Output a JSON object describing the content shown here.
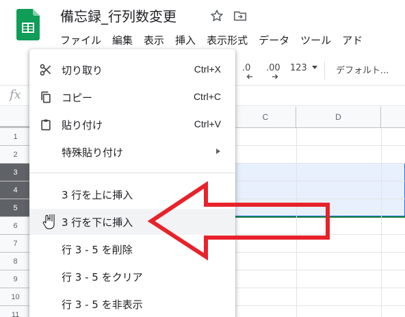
{
  "app": {
    "doc_title": "備忘録_行列数変更",
    "menu": [
      "ファイル",
      "編集",
      "表示",
      "挿入",
      "表示形式",
      "データ",
      "ツール",
      "アド"
    ]
  },
  "toolbar": {
    "decimal_decrease": ".0",
    "decimal_increase": ".00",
    "number_format": "123",
    "font_name": "デフォルト..."
  },
  "formula_bar": {
    "fx_label": "fx"
  },
  "grid": {
    "columns": [
      "C",
      "D"
    ],
    "rows": [
      "1",
      "2",
      "3",
      "4",
      "5",
      "6",
      "7",
      "8",
      "9",
      "10",
      "11"
    ],
    "selected_rows": [
      "3",
      "4",
      "5"
    ]
  },
  "context_menu": {
    "items": [
      {
        "label": "切り取り",
        "shortcut": "Ctrl+X",
        "icon": "scissors-icon"
      },
      {
        "label": "コピー",
        "shortcut": "Ctrl+C",
        "icon": "copy-icon"
      },
      {
        "label": "貼り付け",
        "shortcut": "Ctrl+V",
        "icon": "clipboard-icon"
      },
      {
        "label": "特殊貼り付け",
        "submenu": true
      },
      {
        "label": "3 行を上に挿入"
      },
      {
        "label": "3 行を下に挿入",
        "hovered": true
      },
      {
        "label": "行 3 - 5 を削除"
      },
      {
        "label": "行 3 - 5 をクリア"
      },
      {
        "label": "行 3 - 5 を非表示"
      }
    ]
  },
  "colors": {
    "accent": "#1a73e8",
    "selection_fill": "#e8f0fe",
    "sheets_green": "#0f9d58",
    "annotation_arrow": "#e8222a"
  }
}
